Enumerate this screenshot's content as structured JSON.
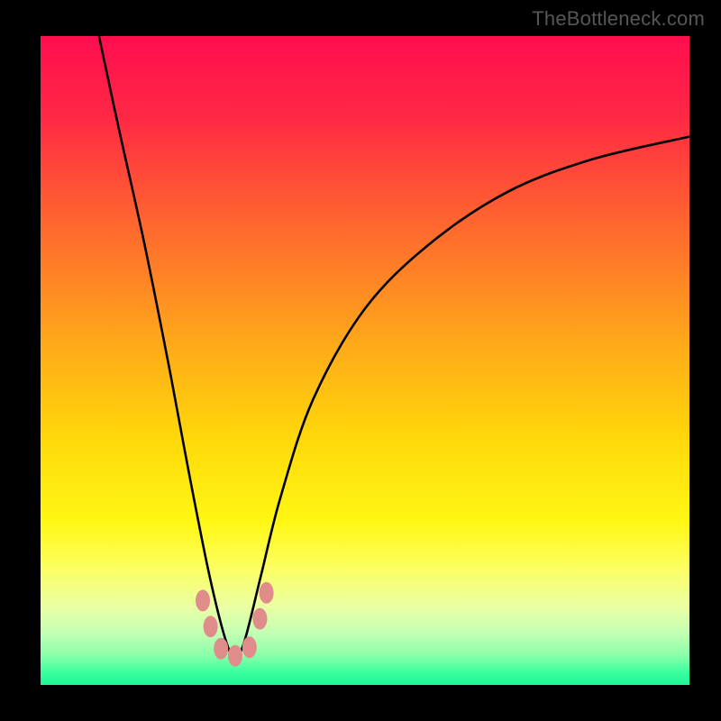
{
  "watermark": "TheBottleneck.com",
  "gradient_stops": [
    {
      "offset": 0.0,
      "color": "#ff0d4f"
    },
    {
      "offset": 0.12,
      "color": "#ff2745"
    },
    {
      "offset": 0.3,
      "color": "#ff6a2d"
    },
    {
      "offset": 0.48,
      "color": "#ffab19"
    },
    {
      "offset": 0.62,
      "color": "#ffd80a"
    },
    {
      "offset": 0.75,
      "color": "#fff714"
    },
    {
      "offset": 0.82,
      "color": "#fcff62"
    },
    {
      "offset": 0.88,
      "color": "#eaffa4"
    },
    {
      "offset": 0.92,
      "color": "#c3ffb4"
    },
    {
      "offset": 0.955,
      "color": "#89ffa8"
    },
    {
      "offset": 0.98,
      "color": "#3dffa0"
    },
    {
      "offset": 1.0,
      "color": "#1cf596"
    }
  ],
  "trough_color": "#df8c8b",
  "trough_points": [
    {
      "x": 0.25,
      "y": 0.87
    },
    {
      "x": 0.262,
      "y": 0.91
    },
    {
      "x": 0.278,
      "y": 0.944
    },
    {
      "x": 0.3,
      "y": 0.955
    },
    {
      "x": 0.322,
      "y": 0.942
    },
    {
      "x": 0.338,
      "y": 0.898
    },
    {
      "x": 0.348,
      "y": 0.858
    }
  ],
  "chart_data": {
    "type": "line",
    "title": "",
    "xlabel": "",
    "ylabel": "",
    "xlim": [
      0,
      1
    ],
    "ylim": [
      0,
      1
    ],
    "note": "x and y are normalized to the plot area (top-left origin). The curve is a V-shaped bottleneck profile dipping to near-zero around x≈0.30 and rising toward the right.",
    "series": [
      {
        "name": "bottleneck-curve",
        "x": [
          0.09,
          0.12,
          0.16,
          0.2,
          0.23,
          0.26,
          0.285,
          0.3,
          0.315,
          0.34,
          0.37,
          0.42,
          0.5,
          0.6,
          0.72,
          0.85,
          1.0
        ],
        "values": [
          0.0,
          0.14,
          0.32,
          0.52,
          0.68,
          0.83,
          0.93,
          0.958,
          0.93,
          0.83,
          0.71,
          0.56,
          0.42,
          0.32,
          0.24,
          0.19,
          0.155
        ]
      }
    ],
    "trough_markers_x": [
      0.25,
      0.262,
      0.278,
      0.3,
      0.322,
      0.338,
      0.348
    ]
  }
}
